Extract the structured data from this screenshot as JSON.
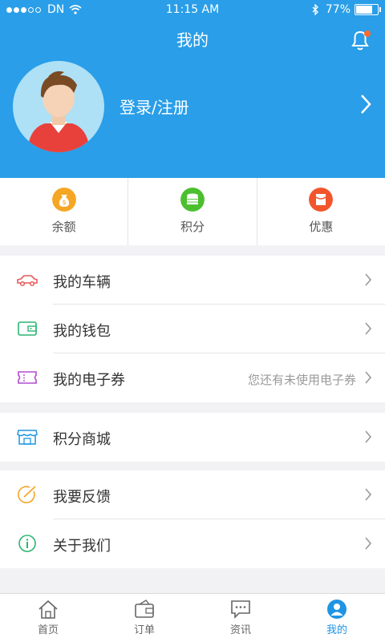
{
  "status_bar": {
    "carrier": "DN",
    "time": "11:15 AM",
    "battery": "77%",
    "battery_level": 0.77
  },
  "header": {
    "title": "我的"
  },
  "profile": {
    "login_label": "登录/注册"
  },
  "stats": [
    {
      "label": "余额",
      "icon": "money-bag-icon",
      "color": "#f5a623"
    },
    {
      "label": "积分",
      "icon": "coins-icon",
      "color": "#4cbf2f"
    },
    {
      "label": "优惠",
      "icon": "coupon-icon",
      "color": "#f2552c"
    }
  ],
  "menu": {
    "vehicle": {
      "label": "我的车辆",
      "icon": "car-icon",
      "color": "#e85a5a"
    },
    "wallet": {
      "label": "我的钱包",
      "icon": "wallet-icon",
      "color": "#2bb673"
    },
    "ecoupon": {
      "label": "我的电子券",
      "hint": "您还有未使用电子券",
      "icon": "ticket-icon",
      "color": "#b44bd0"
    },
    "mall": {
      "label": "积分商城",
      "icon": "store-icon",
      "color": "#1f94e4"
    },
    "feedback": {
      "label": "我要反馈",
      "icon": "feedback-icon",
      "color": "#f5a623"
    },
    "about": {
      "label": "关于我们",
      "icon": "info-icon",
      "color": "#2bb673"
    }
  },
  "tabbar": [
    {
      "label": "首页",
      "icon": "home-icon",
      "active": false
    },
    {
      "label": "订单",
      "icon": "order-icon",
      "active": false
    },
    {
      "label": "资讯",
      "icon": "news-icon",
      "active": false
    },
    {
      "label": "我的",
      "icon": "user-icon",
      "active": true
    }
  ],
  "colors": {
    "primary": "#2a9ee8",
    "active_tab": "#1f94e4",
    "notification": "#ff6a2b"
  }
}
